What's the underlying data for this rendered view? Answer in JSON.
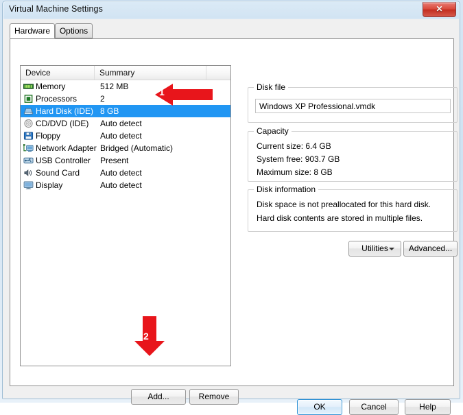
{
  "window": {
    "title": "Virtual Machine Settings",
    "close_label": "✕"
  },
  "tabs": [
    {
      "label": "Hardware",
      "active": true
    },
    {
      "label": "Options",
      "active": false
    }
  ],
  "device_list": {
    "columns": [
      "Device",
      "Summary"
    ],
    "rows": [
      {
        "device": "Memory",
        "summary": "512 MB",
        "icon": "memory-icon",
        "selected": false
      },
      {
        "device": "Processors",
        "summary": "2",
        "icon": "processor-icon",
        "selected": false
      },
      {
        "device": "Hard Disk (IDE)",
        "summary": "8 GB",
        "icon": "hard-disk-icon",
        "selected": true
      },
      {
        "device": "CD/DVD (IDE)",
        "summary": "Auto detect",
        "icon": "cd-dvd-icon",
        "selected": false
      },
      {
        "device": "Floppy",
        "summary": "Auto detect",
        "icon": "floppy-icon",
        "selected": false
      },
      {
        "device": "Network Adapter",
        "summary": "Bridged (Automatic)",
        "icon": "network-adapter-icon",
        "selected": false
      },
      {
        "device": "USB Controller",
        "summary": "Present",
        "icon": "usb-controller-icon",
        "selected": false
      },
      {
        "device": "Sound Card",
        "summary": "Auto detect",
        "icon": "sound-card-icon",
        "selected": false
      },
      {
        "device": "Display",
        "summary": "Auto detect",
        "icon": "display-icon",
        "selected": false
      }
    ],
    "add_label": "Add...",
    "remove_label": "Remove"
  },
  "disk_file": {
    "group_title": "Disk file",
    "value": "Windows XP Professional.vmdk"
  },
  "capacity": {
    "group_title": "Capacity",
    "current_size": "Current size: 6.4 GB",
    "system_free": "System free: 903.7 GB",
    "maximum_size": "Maximum size: 8 GB"
  },
  "disk_information": {
    "group_title": "Disk information",
    "line1": "Disk space is not preallocated for this hard disk.",
    "line2": "Hard disk contents are stored in multiple files."
  },
  "disk_buttons": {
    "utilities_label": "Utilities",
    "advanced_label": "Advanced..."
  },
  "footer": {
    "ok_label": "OK",
    "cancel_label": "Cancel",
    "help_label": "Help"
  },
  "annotations": [
    {
      "number": "1",
      "direction": "left",
      "target": "hard-disk-row"
    },
    {
      "number": "2",
      "direction": "down",
      "target": "add-button"
    }
  ],
  "colors": {
    "selection_blue": "#2196f3",
    "annotation_red": "#e8151b",
    "titlebar_blue": "#d2e4f3",
    "close_red": "#c32e21"
  }
}
